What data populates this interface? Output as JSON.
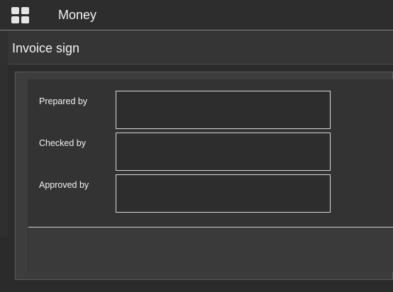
{
  "app": {
    "title": "Money"
  },
  "page": {
    "title": "Invoice sign"
  },
  "fields": [
    {
      "label": "Prepared by",
      "value": ""
    },
    {
      "label": "Checked by",
      "value": ""
    },
    {
      "label": "Approved by",
      "value": ""
    }
  ],
  "icons": {
    "apps": "apps-grid-icon"
  }
}
